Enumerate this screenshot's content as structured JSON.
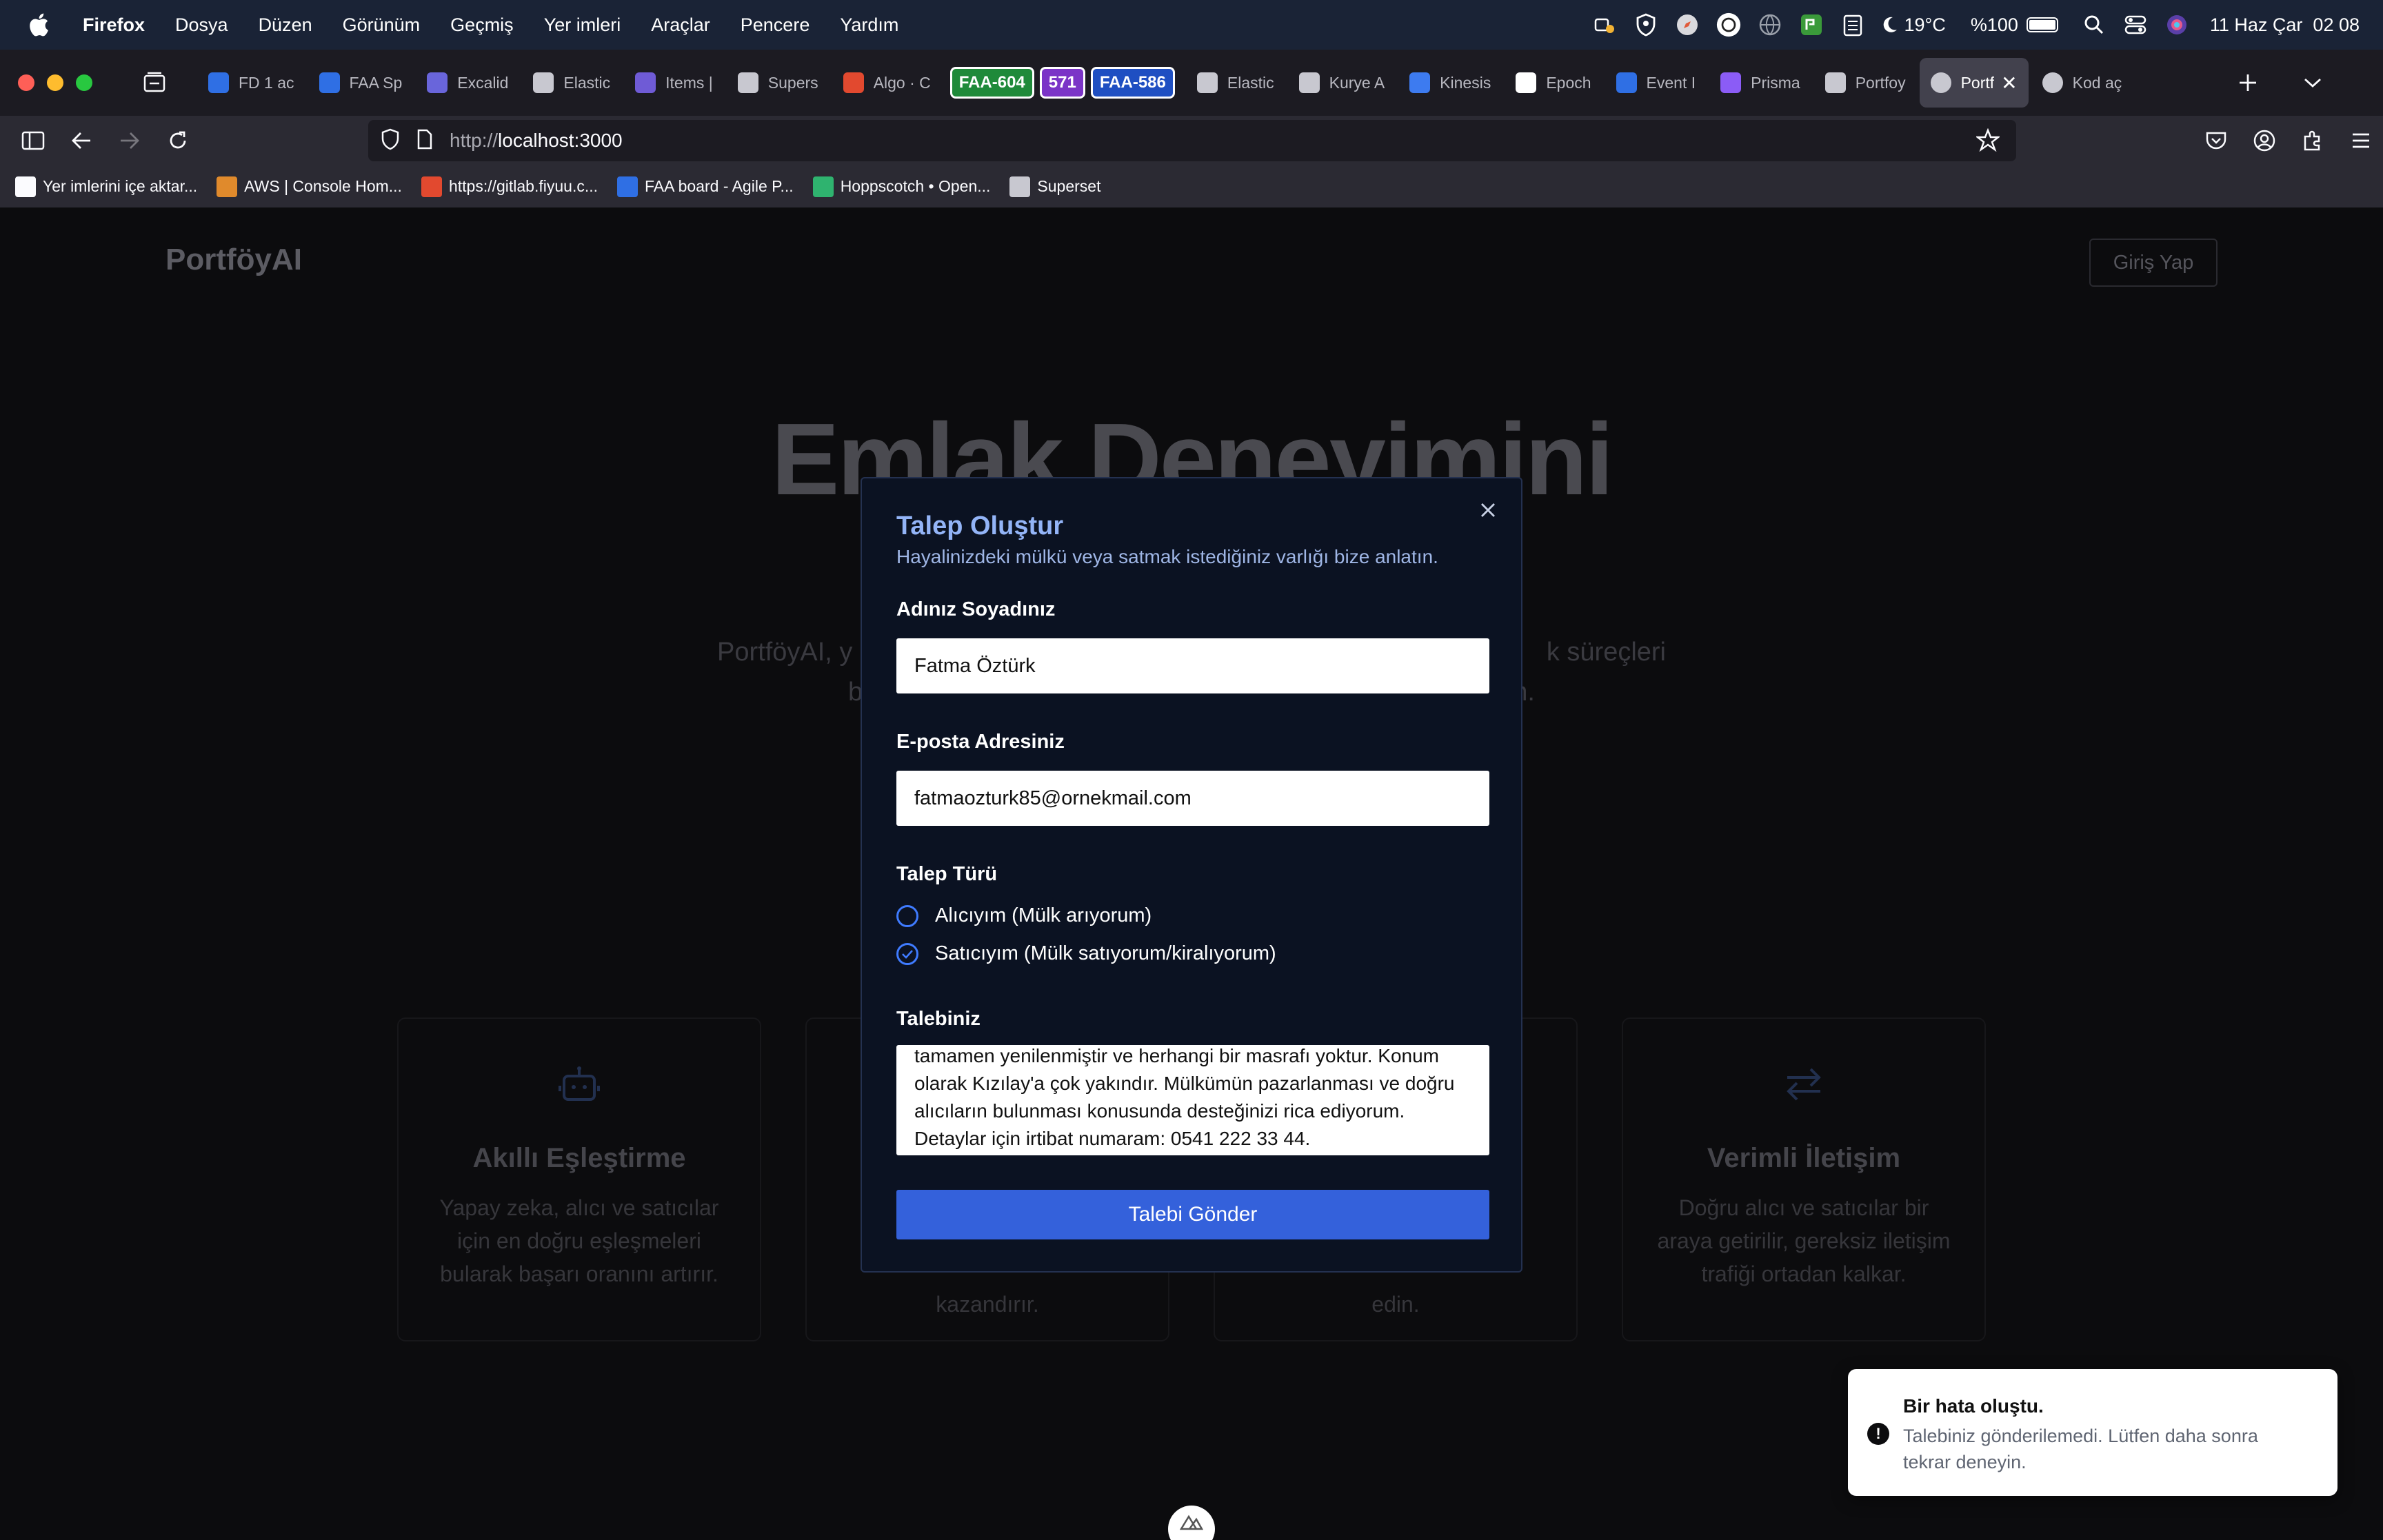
{
  "menubar": {
    "app_name": "Firefox",
    "menus": [
      "Dosya",
      "Düzen",
      "Görünüm",
      "Geçmiş",
      "Yer imleri",
      "Araçlar",
      "Pencere",
      "Yardım"
    ],
    "temperature": "19°C",
    "battery": "%100",
    "battery_level": 1.0,
    "datetime": "11 Haz Çar  02 08"
  },
  "tabs": [
    {
      "label": "FD 1 ac",
      "icon": "jira-icon",
      "color": "#2f6fe4"
    },
    {
      "label": "FAA Sp",
      "icon": "jira-icon",
      "color": "#2f6fe4"
    },
    {
      "label": "Excalid",
      "icon": "excalidraw-icon",
      "color": "#6965db"
    },
    {
      "label": "Elastic",
      "icon": "elastic-icon",
      "color": "#c8c8d0"
    },
    {
      "label": "Items |",
      "icon": "page-icon",
      "color": "#6f5bd6"
    },
    {
      "label": "Supers",
      "icon": "superset-icon",
      "color": "#c8c8d0"
    },
    {
      "label": "Algo · C",
      "icon": "gitlab-icon",
      "color": "#e2492f"
    }
  ],
  "badges": [
    {
      "label": "FAA-604",
      "color": "#1f8a3a"
    },
    {
      "label": "571",
      "color": "#7b34c7"
    },
    {
      "label": "FAA-586",
      "color": "#1f4fc2"
    }
  ],
  "tabs2": [
    {
      "label": "Elastic",
      "icon": "elastic-icon",
      "color": "#c8c8d0"
    },
    {
      "label": "Kurye A",
      "icon": "openai-icon",
      "color": "#c8c8d0"
    },
    {
      "label": "Kinesis",
      "icon": "confluence-icon",
      "color": "#3d7bf0"
    },
    {
      "label": "Epoch",
      "icon": "clock-icon",
      "color": "#ffffff"
    },
    {
      "label": "Event I",
      "icon": "confluence-icon",
      "color": "#2f6fe4"
    },
    {
      "label": "Prisma",
      "icon": "prisma-icon",
      "color": "#8b5cf6"
    },
    {
      "label": "Portfoy",
      "icon": "chatgpt-icon",
      "color": "#c8c8d0"
    }
  ],
  "active_tab": {
    "label": "Portf",
    "icon": "chatgpt-icon"
  },
  "last_tab": {
    "label": "Kod aç",
    "icon": "openai-icon"
  },
  "navbar": {
    "url_scheme": "http://",
    "url_host": "localhost:3000"
  },
  "bookmarks": [
    {
      "label": "Yer imlerini içe aktar...",
      "icon": "import-icon",
      "color": "#fbfbfe"
    },
    {
      "label": "AWS | Console Hom...",
      "icon": "aws-icon",
      "color": "#e08a2c"
    },
    {
      "label": "https://gitlab.fiyuu.c...",
      "icon": "gitlab-icon",
      "color": "#e2492f"
    },
    {
      "label": "FAA board - Agile P...",
      "icon": "jira-icon",
      "color": "#2f6fe4"
    },
    {
      "label": "Hoppscotch • Open...",
      "icon": "hoppscotch-icon",
      "color": "#2fb36f"
    },
    {
      "label": "Superset",
      "icon": "superset-icon",
      "color": "#c8c8d0"
    }
  ],
  "page": {
    "logo": "PortföyAI",
    "login_button": "Giriş Yap",
    "hero_title": "Emlak Deneyimini",
    "hero_text_left": "PortföyAI, y",
    "hero_text_right": "k süreçleri",
    "hero_text_line2_left": "b",
    "hero_text_line2_right": "n.",
    "cards": [
      {
        "title": "Akıllı Eşleştirme",
        "text": "Yapay zeka, alıcı ve satıcılar için en doğru eşleşmeleri bularak başarı oranını artırır.",
        "icon": "robot-icon"
      },
      {
        "title": "",
        "text": "kazandırır.",
        "icon": ""
      },
      {
        "title": "",
        "text": "edin.",
        "icon": ""
      },
      {
        "title": "Verimli İletişim",
        "text": "Doğru alıcı ve satıcılar bir araya getirilir, gereksiz iletişim trafiği ortadan kalkar.",
        "icon": "swap-arrows-icon"
      }
    ]
  },
  "modal": {
    "title": "Talep Oluştur",
    "subtitle": "Hayalinizdeki mülkü veya satmak istediğiniz varlığı bize anlatın.",
    "name_label": "Adınız Soyadınız",
    "name_value": "Fatma Öztürk",
    "email_label": "E-posta Adresiniz",
    "email_value": "fatmaozturk85@ornekmail.com",
    "type_label": "Talep Türü",
    "options": [
      {
        "label": "Alıcıyım (Mülk arıyorum)",
        "checked": false
      },
      {
        "label": "Satıcıyım (Mülk satıyorum/kiralıyorum)",
        "checked": true
      }
    ],
    "request_label": "Talebiniz",
    "request_lines": [
      "tamamen yenilenmiştir ve herhangi bir masrafı yoktur. Konum",
      "olarak Kızılay'a çok yakındır. Mülkümün pazarlanması ve doğru",
      "alıcıların bulunması konusunda desteğinizi rica ediyorum.",
      "Detaylar için irtibat numaram: 0541 222 33 44."
    ],
    "submit": "Talebi Gönder"
  },
  "toast": {
    "title": "Bir hata oluştu.",
    "message": "Talebiniz gönderilemedi. Lütfen daha sonra tekrar deneyin."
  }
}
